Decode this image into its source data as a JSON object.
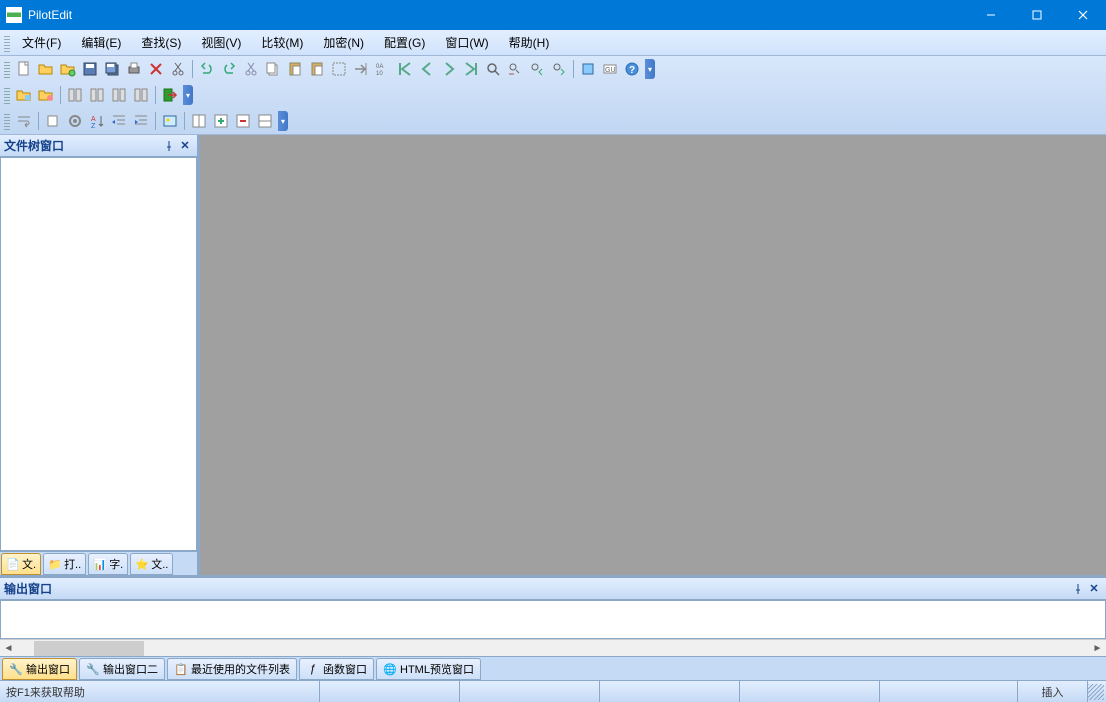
{
  "app": {
    "title": "PilotEdit"
  },
  "menu": {
    "file": "文件(F)",
    "edit": "编辑(E)",
    "find": "查找(S)",
    "view": "视图(V)",
    "compare": "比较(M)",
    "encrypt": "加密(N)",
    "config": "配置(G)",
    "window": "窗口(W)",
    "help": "帮助(H)"
  },
  "left_panel": {
    "title": "文件树窗口",
    "tabs": [
      {
        "label": "文."
      },
      {
        "label": "打.."
      },
      {
        "label": "字."
      },
      {
        "label": "文.."
      }
    ]
  },
  "output_panel": {
    "title": "输出窗口",
    "tabs": [
      {
        "label": "输出窗口"
      },
      {
        "label": "输出窗口二"
      },
      {
        "label": "最近使用的文件列表"
      },
      {
        "label": "函数窗口"
      },
      {
        "label": "HTML预览窗口"
      }
    ]
  },
  "status": {
    "help": "按F1来获取帮助",
    "insert": "插入"
  }
}
